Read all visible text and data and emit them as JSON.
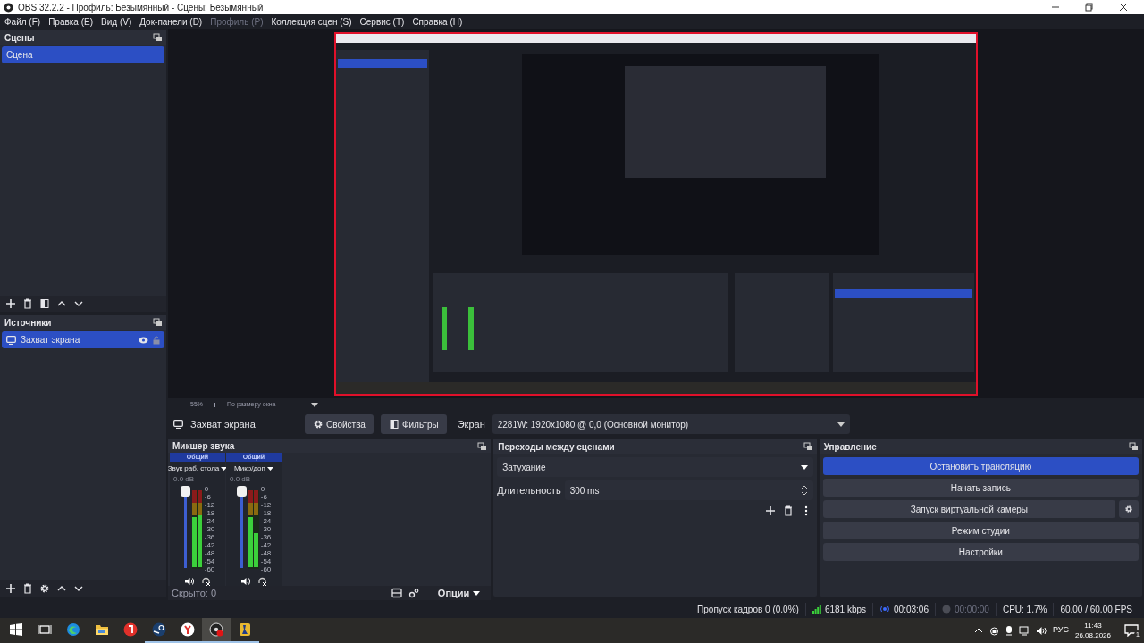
{
  "title_bar": {
    "title": "OBS 32.2.2 - Профиль: Безымянный - Сцены: Безымянный"
  },
  "menu": [
    {
      "label": "Файл (F)",
      "disabled": false
    },
    {
      "label": "Правка (E)",
      "disabled": false
    },
    {
      "label": "Вид (V)",
      "disabled": false
    },
    {
      "label": "Док-панели (D)",
      "disabled": false
    },
    {
      "label": "Профиль (P)",
      "disabled": true
    },
    {
      "label": "Коллекция сцен (S)",
      "disabled": false
    },
    {
      "label": "Сервис (T)",
      "disabled": false
    },
    {
      "label": "Справка (H)",
      "disabled": false
    }
  ],
  "scenes": {
    "title": "Сцены",
    "items": [
      {
        "label": "Сцена",
        "selected": true
      }
    ]
  },
  "sources": {
    "title": "Источники",
    "items": [
      {
        "label": "Захват экрана",
        "selected": true,
        "visible": true,
        "locked": false
      }
    ]
  },
  "preview_bar": {
    "zoom": "55%",
    "fit": "По размеру окна"
  },
  "source_toolbar": {
    "source": "Захват экрана",
    "buttons": [
      "Свойства",
      "Фильтры"
    ],
    "display_label": "Экран",
    "display_value": "2281W: 1920x1080 @ 0,0 (Основной монитор)"
  },
  "mixer": {
    "title": "Микшер звука",
    "hidden": "Скрыто: 0",
    "options": "Опции",
    "channels": [
      {
        "track": "Общий",
        "name": "Звук раб. стола",
        "reading": "0.0 dB",
        "level": 1,
        "muted": false,
        "scale": [
          "0",
          "-6",
          "-12",
          "-18",
          "-24",
          "-30",
          "-36",
          "-42",
          "-48",
          "-54",
          "-60"
        ]
      },
      {
        "track": "Общий",
        "name": "Микр/доп",
        "reading": "0.0 dB",
        "level": 1,
        "muted": false,
        "scale": [
          "0",
          "-6",
          "-12",
          "-18",
          "-24",
          "-30",
          "-36",
          "-42",
          "-48",
          "-54",
          "-60"
        ]
      }
    ]
  },
  "transitions": {
    "title": "Переходы между сценами",
    "transition": "Затухание",
    "duration_label": "Длительность",
    "duration": "300 ms"
  },
  "controls": {
    "title": "Управление",
    "buttons": [
      {
        "label": "Остановить трансляцию",
        "active": true,
        "settings_button": false
      },
      {
        "label": "Начать запись",
        "active": false,
        "settings_button": false
      },
      {
        "label": "Запуск виртуальной камеры",
        "active": false,
        "settings_button": true
      },
      {
        "label": "Режим студии",
        "active": false,
        "settings_button": false
      },
      {
        "label": "Настройки",
        "active": false,
        "settings_button": false
      }
    ]
  },
  "status_bar": {
    "dropped": "Пропуск кадров 0 (0.0%)",
    "bitrate": "6181 kbps",
    "stream_time": "00:03:06",
    "streaming": true,
    "rec_time": "00:00:00",
    "recording": false,
    "cpu": "CPU: 1.7%",
    "fps": "60.00 / 60.00 FPS"
  },
  "taskbar": {
    "apps": [
      {
        "kind": "edge",
        "running": false,
        "active": false
      },
      {
        "kind": "folder",
        "running": false,
        "active": false
      },
      {
        "kind": "yandex",
        "running": false,
        "active": false
      },
      {
        "kind": "steam",
        "running": true,
        "active": false
      },
      {
        "kind": "browser",
        "running": true,
        "active": false
      },
      {
        "kind": "obs",
        "running": true,
        "active": true
      },
      {
        "kind": "game",
        "running": true,
        "active": false
      }
    ],
    "language": "РУС",
    "time": "11:43",
    "date": "26.08.2026",
    "notifications": "1"
  }
}
